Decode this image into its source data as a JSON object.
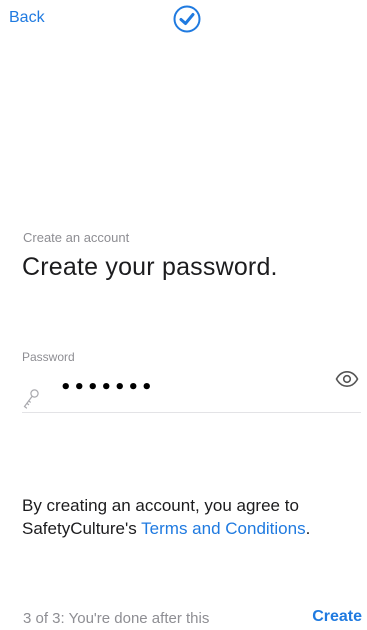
{
  "nav": {
    "back_label": "Back",
    "status_icon": "checkmark-circle-icon"
  },
  "header": {
    "subtitle": "Create an account",
    "title": "Create your password."
  },
  "password_field": {
    "label": "Password",
    "value": "•••••••",
    "leading_icon": "key-icon",
    "trailing_icon": "eye-icon"
  },
  "agreement": {
    "prefix": "By creating an account, you agree to SafetyCulture's ",
    "link_text": "Terms and Conditions",
    "suffix": "."
  },
  "footer": {
    "step_text": "3 of 3: You're done after this",
    "create_label": "Create"
  },
  "colors": {
    "accent": "#1f7ae0",
    "muted_text": "#8e8e93",
    "divider": "#e3e3e6"
  }
}
